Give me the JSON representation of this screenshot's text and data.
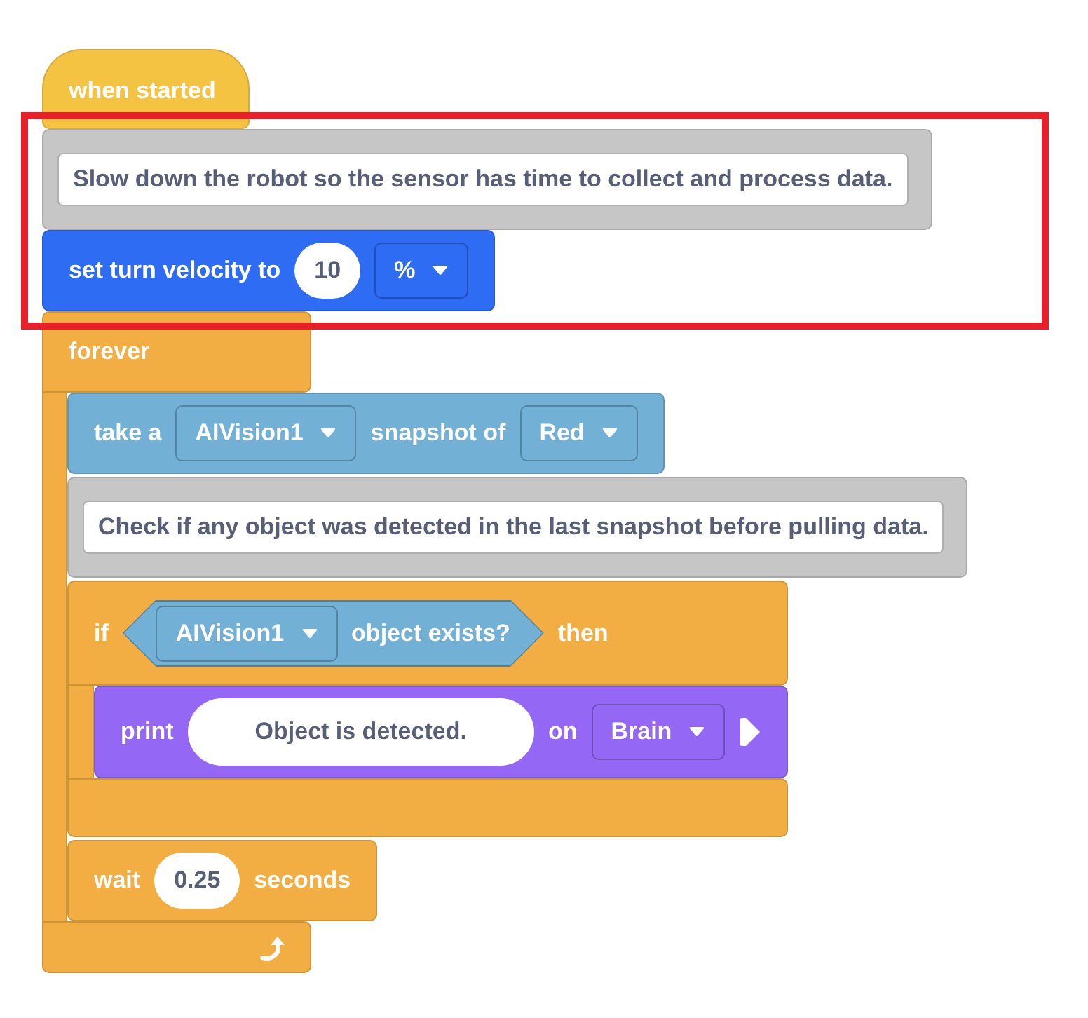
{
  "hat_block": {
    "color": "#f5c342",
    "label": "when started"
  },
  "highlighted_blocks": [
    {
      "kind": "comment",
      "text": "Slow down the robot so the sensor has time to collect and process data."
    },
    {
      "kind": "stack",
      "color": "#2d6cf3",
      "parts": [
        {
          "kind": "label",
          "text": "set turn velocity to"
        },
        {
          "kind": "number",
          "text": "10"
        },
        {
          "kind": "dropdown",
          "text": "%"
        }
      ]
    }
  ],
  "forever_block": {
    "color": "#f2ae43",
    "label": "forever",
    "body": [
      {
        "kind": "stack",
        "color": "#72b0d6",
        "parts": [
          {
            "kind": "label",
            "text": "take a"
          },
          {
            "kind": "dropdown",
            "text": "AIVision1"
          },
          {
            "kind": "label",
            "text": "snapshot of"
          },
          {
            "kind": "dropdown",
            "text": "Red"
          }
        ]
      },
      {
        "kind": "comment",
        "text": "Check if any object was detected in the last snapshot before pulling data."
      },
      {
        "kind": "if",
        "color": "#f2ae43",
        "parts": [
          {
            "kind": "label",
            "text": "if"
          },
          {
            "kind": "boolean",
            "color": "#72b0d6",
            "parts": [
              {
                "kind": "dropdown",
                "text": "AIVision1"
              },
              {
                "kind": "label",
                "text": "object exists?"
              }
            ]
          },
          {
            "kind": "label",
            "text": "then"
          }
        ],
        "body": [
          {
            "kind": "stack",
            "color": "#9468f4",
            "parts": [
              {
                "kind": "label",
                "text": "print"
              },
              {
                "kind": "string",
                "text": "Object is detected."
              },
              {
                "kind": "label",
                "text": "on"
              },
              {
                "kind": "dropdown",
                "text": "Brain"
              },
              {
                "kind": "expand_arrow"
              }
            ]
          }
        ]
      },
      {
        "kind": "stack",
        "color": "#f2ae43",
        "parts": [
          {
            "kind": "label",
            "text": "wait"
          },
          {
            "kind": "number",
            "text": "0.25"
          },
          {
            "kind": "label",
            "text": "seconds"
          }
        ]
      }
    ]
  }
}
